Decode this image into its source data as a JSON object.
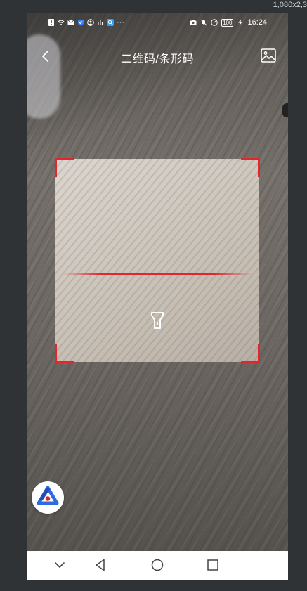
{
  "resolution_text": "1,080x2,3",
  "status_bar": {
    "time": "16:24",
    "battery": "100",
    "more": "···"
  },
  "header": {
    "title": "二维码/条形码",
    "back_icon": "chevron-left-icon",
    "gallery_icon": "image-gallery-icon"
  },
  "scanner": {
    "frame_color": "#e3262c",
    "torch_icon": "flashlight-icon"
  },
  "fab": {
    "icon": "app-logo-icon",
    "colors": [
      "#2f6bdc",
      "#e3262c"
    ]
  },
  "nav_bar": {
    "buttons": [
      "chevron-down-icon",
      "back-triangle-icon",
      "home-circle-icon",
      "recents-square-icon"
    ]
  }
}
